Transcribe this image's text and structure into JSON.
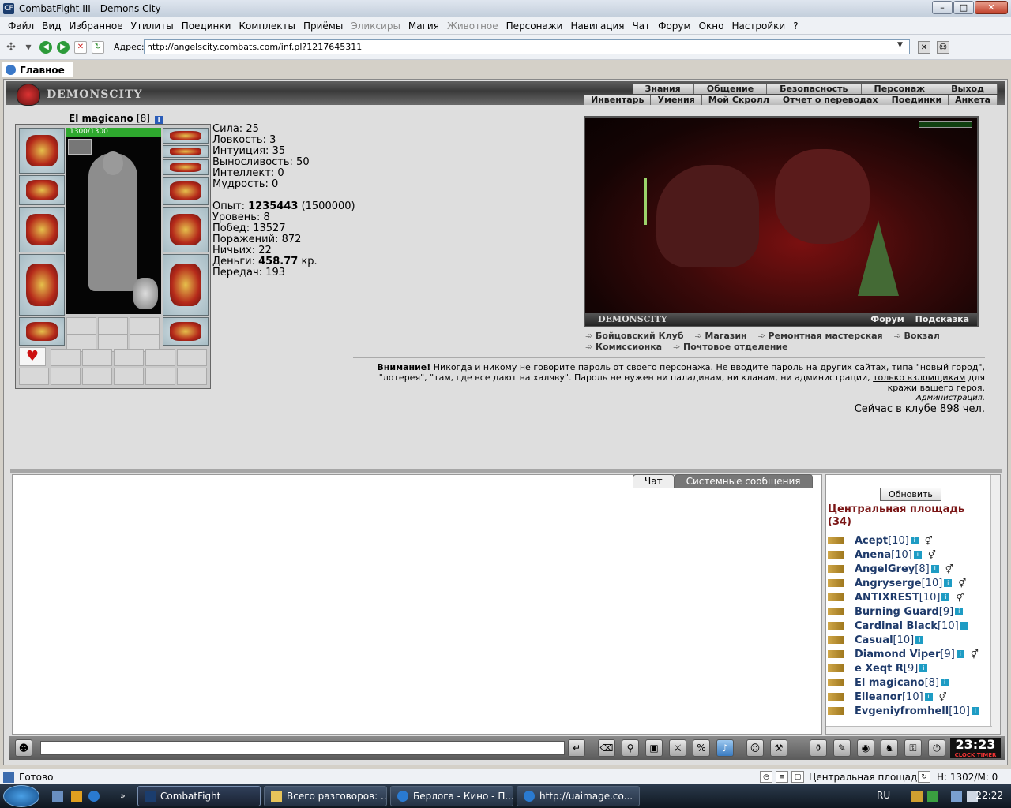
{
  "window": {
    "title": "CombatFight III - Demons City",
    "app_icon": "cf-icon"
  },
  "menu": [
    "Файл",
    "Вид",
    "Избранное",
    "Утилиты",
    "Поединки",
    "Комплекты",
    "Приёмы",
    "Эликсиры",
    "Магия",
    "Животное",
    "Персонажи",
    "Навигация",
    "Чат",
    "Форум",
    "Окно",
    "Настройки",
    "?"
  ],
  "menu_disabled": [
    "Эликсиры",
    "Животное"
  ],
  "address": {
    "label": "Адрес:",
    "url": "http://angelscity.combats.com/inf.pl?1217645311"
  },
  "tab": {
    "label": "Главное"
  },
  "site": {
    "logo": "DEMONSCITY",
    "nav1": [
      "Знания",
      "Общение",
      "Безопасность",
      "Персонаж",
      "Выход"
    ],
    "nav2": [
      "Инвентарь",
      "Умения",
      "Мой Скролл",
      "Отчет о переводах",
      "Поединки",
      "Анкета"
    ]
  },
  "character": {
    "name": "El magicano",
    "level": "[8]",
    "info_icon": "i",
    "hp": "1300/1300",
    "hp_fraction": 1.0
  },
  "stats": {
    "strength": "Сила: 25",
    "agility": "Ловкость: 3",
    "intuition": "Интуиция: 35",
    "endurance": "Выносливость: 50",
    "intellect": "Интеллект: 0",
    "wisdom": "Мудрость: 0",
    "exp_label": "Опыт:",
    "exp_value": "1235443",
    "exp_next": "(1500000)",
    "level": "Уровень: 8",
    "wins": "Побед: 13527",
    "losses": "Поражений: 872",
    "draws": "Ничьих: 22",
    "money_label": "Деньги:",
    "money_value": "458.77",
    "money_unit": "кр.",
    "transfers": "Передач: 193"
  },
  "scene": {
    "brand": "DEMONSCITY",
    "links": [
      "Форум",
      "Подсказка"
    ]
  },
  "places": {
    "row1": [
      "Бойцовский Клуб",
      "Магазин",
      "Ремонтная мастерская",
      "Вокзал"
    ],
    "row2": [
      "Комиссионка",
      "Почтовое отделение"
    ]
  },
  "notice": {
    "bold": "Внимание!",
    "text1": " Никогда и никому не говорите пароль от своего персонажа. Не вводите пароль на других сайтах, типа \"новый город\", \"лотерея\", \"там, где все дают на халяву\". Пароль не нужен ни паладинам, ни кланам, ни администрации, ",
    "link": "только взломщикам",
    "text2": " для кражи вашего героя.",
    "sign": "Администрация.",
    "online": "Сейчас в клубе 898 чел."
  },
  "chat": {
    "tabs": [
      "Чат",
      "Системные сообщения"
    ],
    "refresh": "Обновить",
    "room": "Центральная площадь",
    "room_count": "(34)",
    "users": [
      {
        "name": "Acept",
        "level": "[10]",
        "invite": true
      },
      {
        "name": "Anena",
        "level": "[10]",
        "invite": true
      },
      {
        "name": "AngelGrey",
        "level": "[8]",
        "invite": true
      },
      {
        "name": "Angryserge",
        "level": "[10]",
        "invite": true
      },
      {
        "name": "ANTIXREST",
        "level": "[10]",
        "invite": true
      },
      {
        "name": "Burning Guard",
        "level": "[9]",
        "invite": false
      },
      {
        "name": "Cardinal Black",
        "level": "[10]",
        "invite": false
      },
      {
        "name": "Casual",
        "level": "[10]",
        "invite": false
      },
      {
        "name": "Diamond Viper",
        "level": "[9]",
        "invite": true
      },
      {
        "name": "e Xeqt R",
        "level": "[9]",
        "invite": false
      },
      {
        "name": "El magicano",
        "level": "[8]",
        "invite": false
      },
      {
        "name": "Elleanor",
        "level": "[10]",
        "invite": true
      },
      {
        "name": "Evgeniyfromhell",
        "level": "[10]",
        "invite": false
      }
    ]
  },
  "toolbar": {
    "clock": "23:23",
    "clock_sub": "CLOCK TIMER"
  },
  "status": {
    "left": "Готово",
    "room": "Центральная площадь",
    "mem": "H: 1302/M: 0"
  },
  "taskbar": {
    "buttons": [
      "CombatFight",
      "Всего разговоров: ...",
      "Берлога - Кино - П...",
      "http://uaimage.co..."
    ],
    "lang": "RU",
    "time": "22:22"
  }
}
